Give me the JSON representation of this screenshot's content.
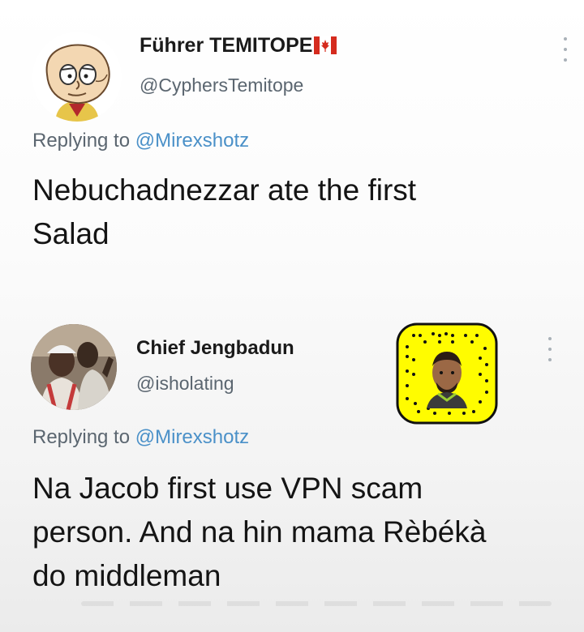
{
  "tweets": [
    {
      "display_name": "Führer TEMITOPE",
      "flag_icon": "canada-flag-icon",
      "handle": "@CyphersTemitope",
      "replying_prefix": "Replying to",
      "replying_to": "@Mirexshotz",
      "text_lines": [
        "Nebuchadnezzar ate the first",
        "Salad"
      ]
    },
    {
      "display_name": "Chief Jengbadun",
      "handle": "@isholating",
      "snapcode_icon": "snapchat-snapcode-icon",
      "replying_prefix": "Replying to",
      "replying_to": "@Mirexshotz",
      "text_lines": [
        "Na Jacob first use VPN scam",
        "person. And na hin mama Rèbékà",
        "do middleman"
      ]
    }
  ],
  "colors": {
    "handle_gray": "#5b6670",
    "mention_blue": "#4a90c8",
    "snapcode_yellow": "#fffc00"
  }
}
